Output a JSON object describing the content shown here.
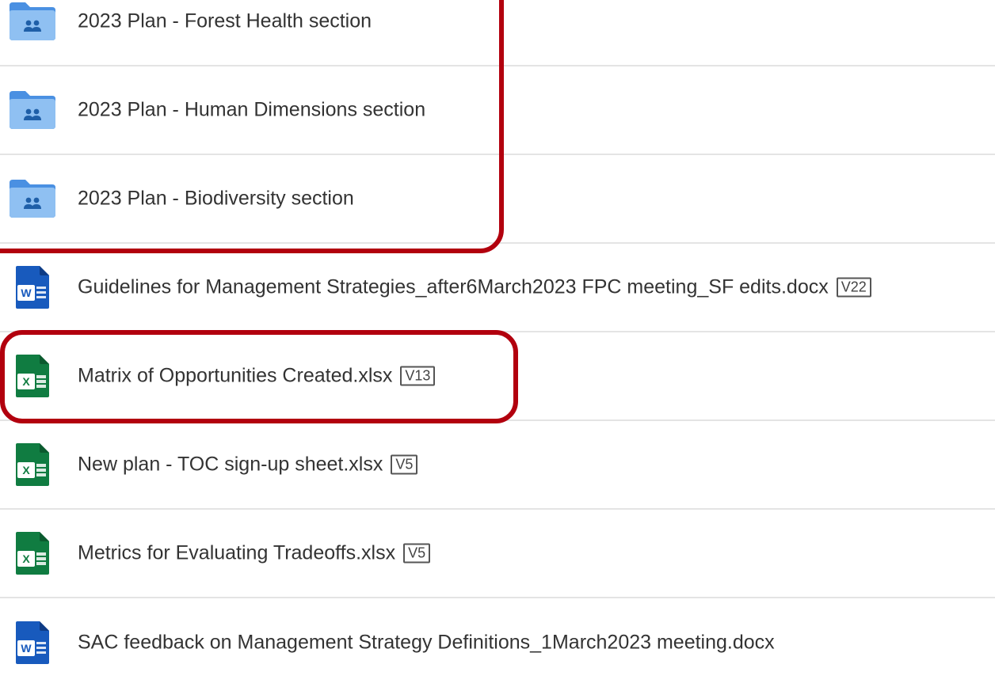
{
  "colors": {
    "folder_blue": "#4a90e2",
    "folder_blue_light": "#8fc0f2",
    "word_blue": "#185abd",
    "excel_green": "#107c41",
    "highlight_red": "#b2000e"
  },
  "files": [
    {
      "icon": "shared-folder-icon",
      "name": "2023 Plan - Forest Health section",
      "version": ""
    },
    {
      "icon": "shared-folder-icon",
      "name": "2023 Plan - Human Dimensions section",
      "version": ""
    },
    {
      "icon": "shared-folder-icon",
      "name": "2023 Plan - Biodiversity section",
      "version": ""
    },
    {
      "icon": "word-doc-icon",
      "name": "Guidelines for Management Strategies_after6March2023 FPC meeting_SF edits.docx",
      "version": "V22"
    },
    {
      "icon": "excel-sheet-icon",
      "name": "Matrix of Opportunities Created.xlsx",
      "version": "V13"
    },
    {
      "icon": "excel-sheet-icon",
      "name": "New plan - TOC sign-up sheet.xlsx",
      "version": "V5"
    },
    {
      "icon": "excel-sheet-icon",
      "name": "Metrics for Evaluating Tradeoffs.xlsx",
      "version": "V5"
    },
    {
      "icon": "word-doc-icon",
      "name": "SAC feedback on Management Strategy Definitions_1March2023 meeting.docx",
      "version": ""
    }
  ]
}
